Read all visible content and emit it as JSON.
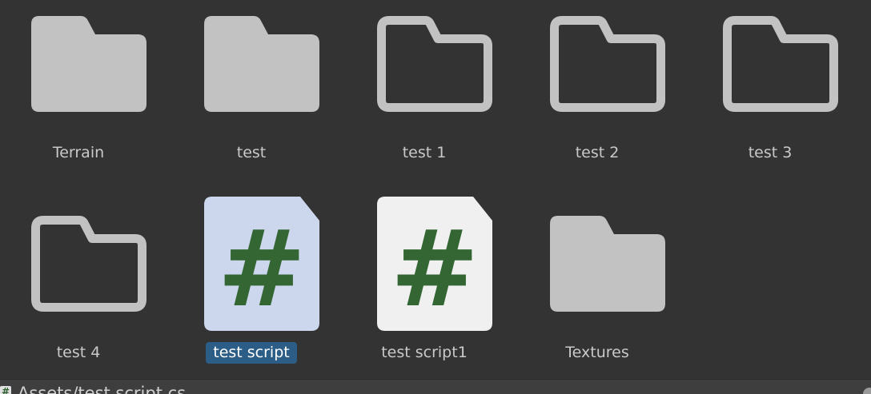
{
  "items": [
    {
      "label": "Terrain",
      "type": "folder-filled",
      "selected": false
    },
    {
      "label": "test",
      "type": "folder-filled",
      "selected": false
    },
    {
      "label": "test 1",
      "type": "folder-empty",
      "selected": false
    },
    {
      "label": "test 2",
      "type": "folder-empty",
      "selected": false
    },
    {
      "label": "test 3",
      "type": "folder-empty",
      "selected": false
    },
    {
      "label": "test 4",
      "type": "folder-empty",
      "selected": false
    },
    {
      "label": "test script",
      "type": "csharp-script",
      "selected": true
    },
    {
      "label": "test script1",
      "type": "csharp-script",
      "selected": false
    },
    {
      "label": "Textures",
      "type": "folder-filled",
      "selected": false
    }
  ],
  "status_bar": {
    "file_icon": "csharp-script-icon",
    "path": "Assets/test script.cs"
  },
  "colors": {
    "background": "#333333",
    "folder": "#c2c2c2",
    "selection": "#2c5d87",
    "script_selected_bg": "#ccd7ee",
    "script_bg": "#f0f0f0",
    "hash": "#336633"
  }
}
